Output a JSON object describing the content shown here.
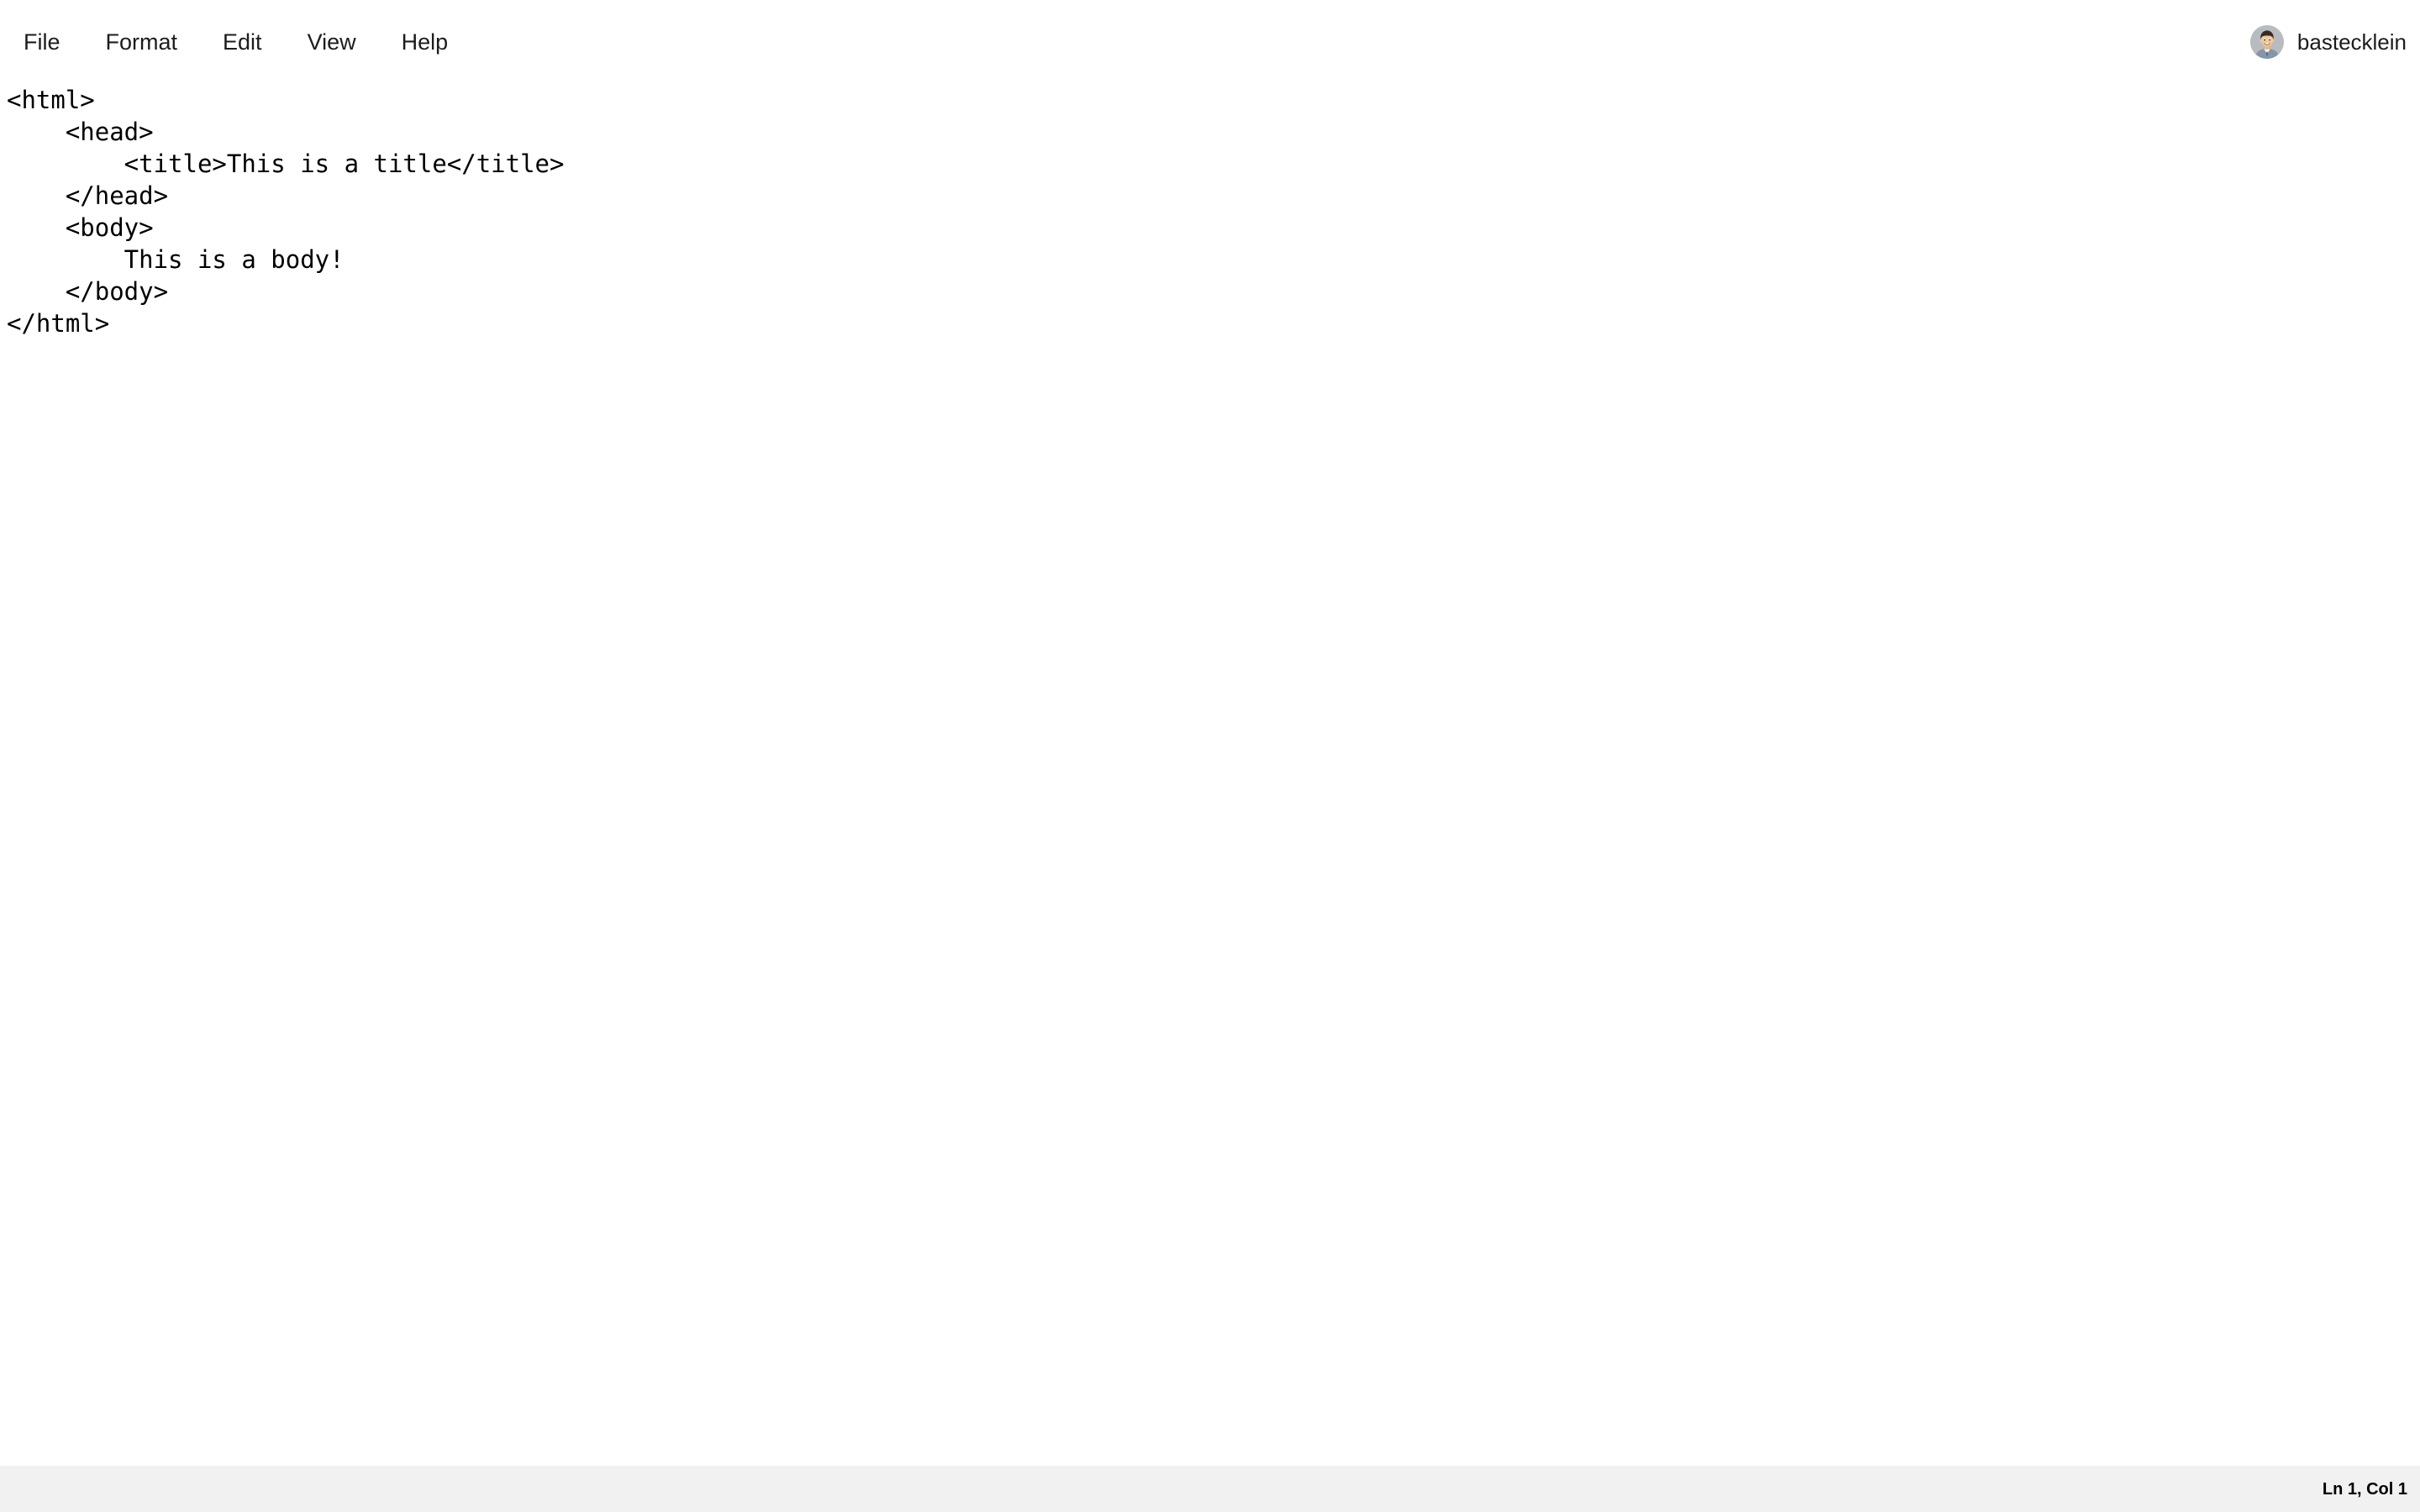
{
  "window": {
    "background_color": "#ffffff"
  },
  "menubar": {
    "items": [
      {
        "label": "File",
        "name": "menu-item-file"
      },
      {
        "label": "Format",
        "name": "menu-item-format"
      },
      {
        "label": "Edit",
        "name": "menu-item-edit"
      },
      {
        "label": "View",
        "name": "menu-item-view"
      },
      {
        "label": "Help",
        "name": "menu-item-help"
      }
    ],
    "user": {
      "username": "bastecklein",
      "avatar_icon": "user-avatar-icon",
      "avatar_background": "#b8bcc0",
      "hair_color": "#3b2a22",
      "skin_color": "#f2c89a",
      "jacket_color": "#8795a8",
      "shirt_color": "#ffffff"
    }
  },
  "editor": {
    "name": "code-editor",
    "language": "html",
    "text_color": "#000000",
    "background_color": "#ffffff",
    "placeholder": "",
    "content": "<html>\n    <head>\n        <title>This is a title</title>\n    </head>\n    <body>\n        This is a body!\n    </body>\n</html>",
    "lines": [
      "<html>",
      "    <head>",
      "        <title>This is a title</title>",
      "    </head>",
      "    <body>",
      "        This is a body!",
      "    </body>",
      "</html>"
    ]
  },
  "statusbar": {
    "background_color": "#f1f1f1",
    "cursor_position": "Ln 1, Col 1",
    "line": 1,
    "column": 1
  }
}
